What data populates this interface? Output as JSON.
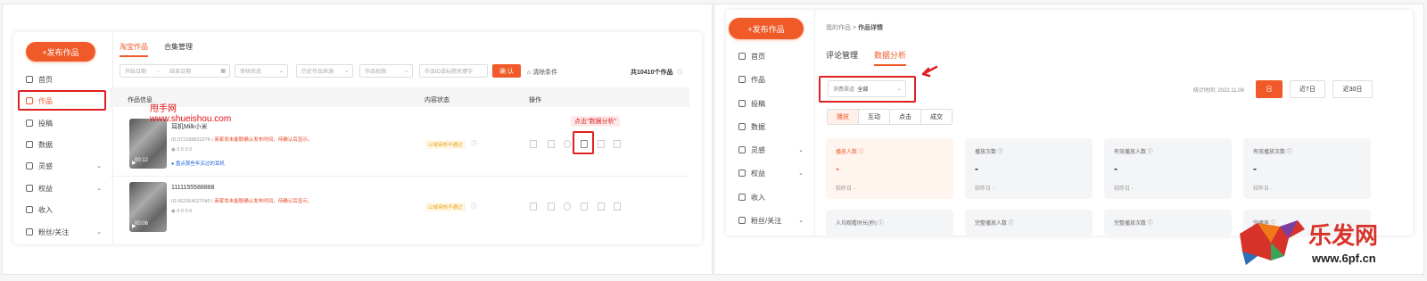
{
  "left": {
    "publish_label": "+发布作品",
    "nav": [
      {
        "label": "首页",
        "icon": "home-icon",
        "chevron": ""
      },
      {
        "label": "作品",
        "icon": "works-icon",
        "chevron": ""
      },
      {
        "label": "投稿",
        "icon": "submit-icon",
        "chevron": ""
      },
      {
        "label": "数据",
        "icon": "data-icon",
        "chevron": ""
      },
      {
        "label": "灵感",
        "icon": "bulb-icon",
        "chevron": "⌄"
      },
      {
        "label": "权益",
        "icon": "badge-icon",
        "chevron": "⌄"
      },
      {
        "label": "收入",
        "icon": "income-icon",
        "chevron": ""
      },
      {
        "label": "粉丝/关注",
        "icon": "fans-icon",
        "chevron": "⌄"
      }
    ],
    "tabs": [
      "淘宝作品",
      "合集管理"
    ],
    "filters": {
      "start_date": "开始日期",
      "arrow": "→",
      "end_date": "结束日期",
      "audit_status": "审核状态",
      "history_source": "历史作品来源",
      "work_perm": "作品权限",
      "keyword": "作品ID或标题关键字"
    },
    "confirm_label": "确 认",
    "clear_label": "清除条件",
    "total_label": "共10410个作品",
    "table_headers": [
      "作品信息",
      "内容状态",
      "操作"
    ],
    "rows": [
      {
        "title": "耳机Milk小米",
        "id_text": "ID:372188831276 | ",
        "warn_text": "商家尚未能联确认发布时间，待确认后显示。",
        "stats": "0  0  0  0",
        "tag": "盘点那些年买过的耳机",
        "duration": "00:12",
        "status": "公域审核不通过"
      },
      {
        "title": "1111155588888",
        "id_text": "ID:362364027040 | ",
        "warn_text": "商家尚未能联确认发布时间，待确认后显示。",
        "stats": "0  0  0  0",
        "tag": "",
        "duration": "00:06",
        "status": "公域审核不通过"
      }
    ],
    "watermark_line1": "甩手网",
    "watermark_line2": "www.shueishou.com",
    "callout": "点击\"数据分析\""
  },
  "right": {
    "publish_label": "+发布作品",
    "nav": [
      {
        "label": "首页",
        "icon": "home-icon",
        "chevron": ""
      },
      {
        "label": "作品",
        "icon": "works-icon",
        "chevron": ""
      },
      {
        "label": "投稿",
        "icon": "submit-icon",
        "chevron": ""
      },
      {
        "label": "数据",
        "icon": "data-icon",
        "chevron": ""
      },
      {
        "label": "灵感",
        "icon": "bulb-icon",
        "chevron": "⌄"
      },
      {
        "label": "权益",
        "icon": "badge-icon",
        "chevron": "⌄"
      },
      {
        "label": "收入",
        "icon": "income-icon",
        "chevron": ""
      },
      {
        "label": "粉丝/关注",
        "icon": "fans-icon",
        "chevron": "⌄"
      }
    ],
    "breadcrumb_parent": "我的作品",
    "breadcrumb_sep": ">",
    "breadcrumb_current": "作品详情",
    "tabs": [
      "评论管理",
      "数据分析"
    ],
    "channel_label": "消费渠道",
    "channel_value": "全部",
    "stat_time": "统计时间: 2022.11.06",
    "ranges": [
      "日",
      "近7日",
      "近30日"
    ],
    "segments": [
      "播放",
      "互动",
      "点击",
      "成交"
    ],
    "cards": [
      {
        "label": "播放人数 ⓘ",
        "value": "-",
        "cmp": "较昨日 -"
      },
      {
        "label": "播放次数 ⓘ",
        "value": "-",
        "cmp": "较昨日 -"
      },
      {
        "label": "有效播放人数 ⓘ",
        "value": "-",
        "cmp": "较昨日 -"
      },
      {
        "label": "有效播放次数 ⓘ",
        "value": "-",
        "cmp": "较昨日 -"
      },
      {
        "label": "人均观看时长(秒) ⓘ",
        "value": "",
        "cmp": ""
      },
      {
        "label": "完整播放人数 ⓘ",
        "value": "",
        "cmp": ""
      },
      {
        "label": "完整播放次数 ⓘ",
        "value": "",
        "cmp": ""
      },
      {
        "label": "完播率 ⓘ",
        "value": "",
        "cmp": ""
      }
    ]
  },
  "logo": {
    "text": "乐发网",
    "url": "www.6pf.cn"
  },
  "colors": {
    "accent": "#f05a28",
    "highlight": "#e02020"
  }
}
